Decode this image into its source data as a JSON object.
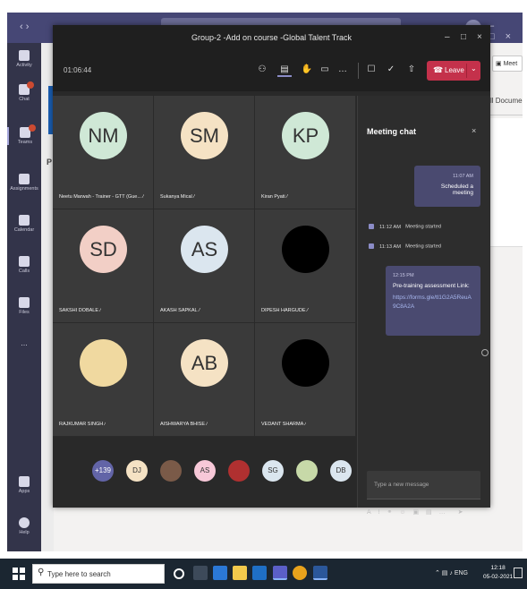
{
  "background_app": {
    "meet_label": "Meet",
    "documents_label": "Documents",
    "rail": [
      {
        "icon": "activity-icon",
        "label": "Activity"
      },
      {
        "icon": "chat-icon",
        "label": "Chat"
      },
      {
        "icon": "teams-icon",
        "label": "Teams"
      },
      {
        "icon": "assignments-icon",
        "label": "Assignments"
      },
      {
        "icon": "calendar-icon",
        "label": "Calendar"
      },
      {
        "icon": "calls-icon",
        "label": "Calls"
      },
      {
        "icon": "files-icon",
        "label": "Files"
      },
      {
        "icon": "more-icon",
        "label": "..."
      },
      {
        "icon": "apps-icon",
        "label": "Apps"
      },
      {
        "icon": "help-icon",
        "label": "Help"
      }
    ]
  },
  "meeting": {
    "title": "Group-2 -Add on course -Global Talent Track",
    "timer": "01:06:44",
    "leave_label": "Leave",
    "participants": [
      {
        "initials": "NM",
        "name": "Neetu Marwah - Trainer - GTT (Gue...",
        "color": "#cfe8d6"
      },
      {
        "initials": "SM",
        "name": "Sukanya Mical",
        "color": "#f5e2c4"
      },
      {
        "initials": "KP",
        "name": "Kiran Pyati",
        "color": "#cfe8d6"
      },
      {
        "initials": "SD",
        "name": "SAKSHI DOBALE",
        "color": "#f2cfc6"
      },
      {
        "initials": "AS",
        "name": "AKASH SAPKAL",
        "color": "#dbe6ef"
      },
      {
        "initials": "",
        "name": "DIPESH HARGUDE",
        "color": "#000000"
      },
      {
        "initials": "",
        "name": "RAJKUMAR SINGH",
        "color": "#f0d9a0"
      },
      {
        "initials": "AB",
        "name": "AISHWARYA BHISE",
        "color": "#f5e2c4"
      },
      {
        "initials": "",
        "name": "VEDANT SHARMA",
        "color": "#000000"
      }
    ],
    "roster": [
      {
        "label": "+139",
        "color": "#6264a7"
      },
      {
        "label": "DJ",
        "color": "#f5e2c4"
      },
      {
        "label": "",
        "color": "#7a5a48"
      },
      {
        "label": "AS",
        "color": "#f7c8d8"
      },
      {
        "label": "",
        "color": "#b03030"
      },
      {
        "label": "SG",
        "color": "#dbe6ef"
      },
      {
        "label": "",
        "color": "#c7d9a8"
      },
      {
        "label": "DB",
        "color": "#dbe6ef"
      }
    ]
  },
  "chat": {
    "title": "Meeting chat",
    "messages": [
      {
        "time": "11:07 AM",
        "text": "Scheduled a meeting"
      },
      {
        "time": "12:15 PM",
        "text": "Pre-training assessment Link:",
        "link": "https://forms.gle/tl1G2A5ReuA9C8A2A"
      }
    ],
    "events": [
      {
        "time": "11:12 AM",
        "text": "Meeting started"
      },
      {
        "time": "11:13 AM",
        "text": "Meeting started"
      }
    ],
    "compose_placeholder": "Type a new message"
  },
  "taskbar": {
    "search_placeholder": "Type here to search",
    "tray_lang": "ENG",
    "time": "12:18",
    "date": "05-02-2021"
  }
}
